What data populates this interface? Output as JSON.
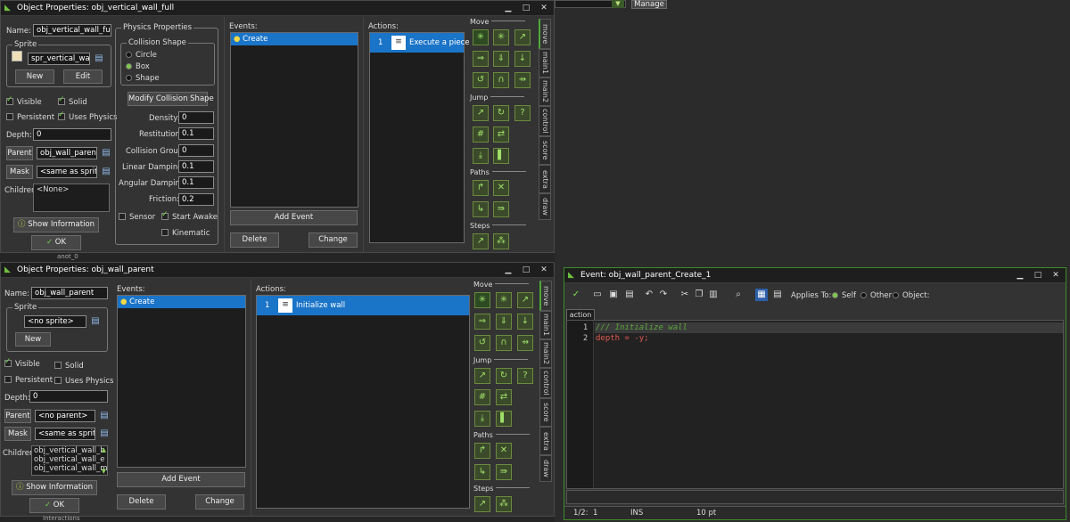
{
  "top_strip": {
    "manage_label": "Manage"
  },
  "win1": {
    "title": "Object Properties: obj_vertical_wall_full",
    "name_label": "Name:",
    "name_value": "obj_vertical_wall_full",
    "sprite_group": "Sprite",
    "sprite_value": "spr_vertical_wall_",
    "new_label": "New",
    "edit_label": "Edit",
    "visible_label": "Visible",
    "solid_label": "Solid",
    "persistent_label": "Persistent",
    "uses_physics_label": "Uses Physics",
    "depth_label": "Depth:",
    "depth_value": "0",
    "parent_label": "Parent",
    "parent_value": "obj_wall_parent",
    "mask_label": "Mask",
    "mask_value": "<same as sprite>",
    "children_label": "Children:",
    "children_value": "<None>",
    "show_info_label": "Show Information",
    "ok_label": "OK",
    "physics_group": "Physics Properties",
    "collision_shape_group": "Collision Shape",
    "shape_circle": "Circle",
    "shape_box": "Box",
    "shape_shape": "Shape",
    "modify_collision_label": "Modify Collision Shape",
    "density_label": "Density:",
    "density_value": "0",
    "restitution_label": "Restitution:",
    "restitution_value": "0.1",
    "collision_group_label": "Collision Group:",
    "collision_group_value": "0",
    "linear_damping_label": "Linear Damping:",
    "linear_damping_value": "0.1",
    "angular_damping_label": "Angular Damping:",
    "angular_damping_value": "0.1",
    "friction_label": "Friction:",
    "friction_value": "0.2",
    "sensor_label": "Sensor",
    "start_awake_label": "Start Awake",
    "kinematic_label": "Kinematic",
    "events_label": "Events:",
    "event_create": "Create",
    "add_event_label": "Add Event",
    "delete_label": "Delete",
    "change_label": "Change",
    "actions_label": "Actions:",
    "action_num": "1",
    "action_text": "Execute a piece"
  },
  "win2": {
    "title": "Object Properties: obj_wall_parent",
    "name_label": "Name:",
    "name_value": "obj_wall_parent",
    "sprite_group": "Sprite",
    "sprite_value": "<no sprite>",
    "new_label": "New",
    "visible_label": "Visible",
    "solid_label": "Solid",
    "persistent_label": "Persistent",
    "uses_physics_label": "Uses Physics",
    "depth_label": "Depth:",
    "depth_value": "0",
    "parent_label": "Parent",
    "parent_value": "<no parent>",
    "mask_label": "Mask",
    "mask_value": "<same as sprite>",
    "children_label": "Children:",
    "children": [
      "obj_vertical_wall_b",
      "obj_vertical_wall_e",
      "obj_vertical_wall_m"
    ],
    "show_info_label": "Show Information",
    "ok_label": "OK",
    "events_label": "Events:",
    "event_create": "Create",
    "add_event_label": "Add Event",
    "delete_label": "Delete",
    "change_label": "Change",
    "actions_label": "Actions:",
    "action_num": "1",
    "action_text": "Initialize wall"
  },
  "palette": {
    "move": "Move",
    "jump": "Jump",
    "paths": "Paths",
    "steps": "Steps",
    "tabs": [
      "move",
      "main1",
      "main2",
      "control",
      "score",
      "extra",
      "draw"
    ]
  },
  "editor": {
    "title": "Event: obj_wall_parent_Create_1",
    "applies_to": "Applies To:",
    "self_label": "Self",
    "other_label": "Other",
    "object_label": "Object:",
    "tab_action": "action",
    "lines": [
      {
        "num": "1",
        "code": "/// Initialize wall"
      },
      {
        "num": "2",
        "code": "depth = -y;"
      }
    ],
    "status_pos": "1/2:",
    "status_col": "1",
    "status_mode": "INS",
    "status_font": "10 pt"
  },
  "bottom_labels": {
    "tree1": "anot_0",
    "tree2": "Interactions"
  }
}
